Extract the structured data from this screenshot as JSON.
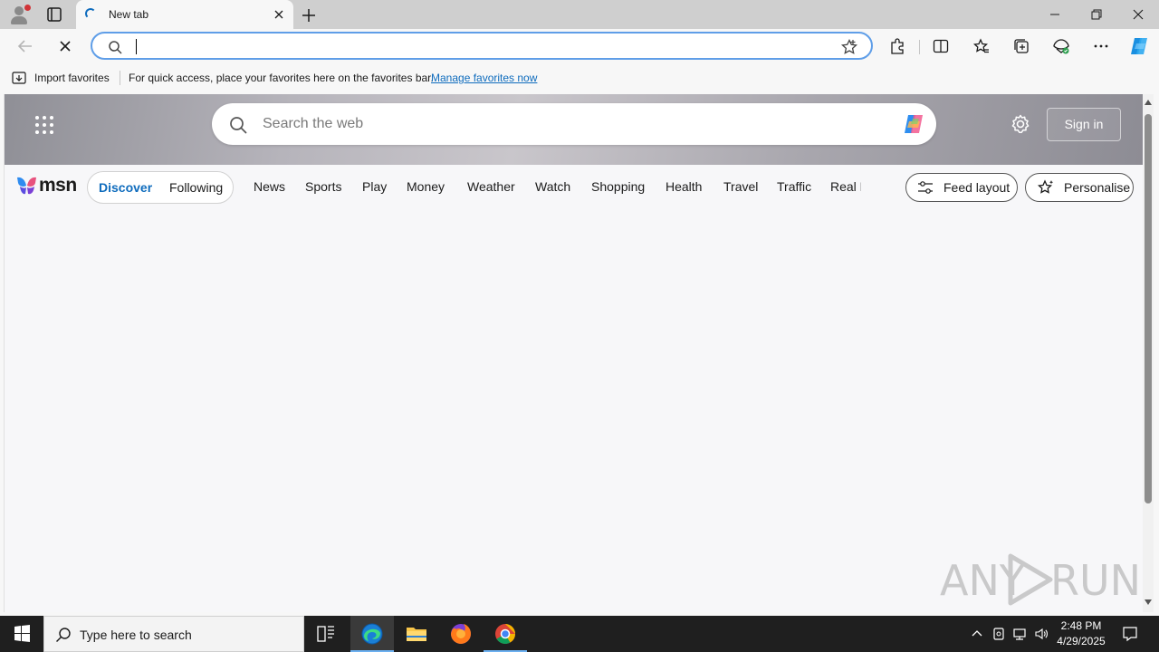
{
  "browser": {
    "tab_title": "New tab",
    "address_value": "",
    "favorites_bar": {
      "import_label": "Import favorites",
      "message": "For quick access, place your favorites here on the favorites bar.",
      "link": "Manage favorites now"
    }
  },
  "msn": {
    "search_placeholder": "Search the web",
    "sign_in": "Sign in",
    "logo_text": "msn",
    "feed_tabs": [
      "Discover",
      "Following"
    ],
    "nav_links": [
      "News",
      "Sports",
      "Play",
      "Money",
      "Weather",
      "Watch",
      "Shopping",
      "Health",
      "Travel",
      "Traffic",
      "Real E"
    ],
    "feed_layout": "Feed layout",
    "personalise": "Personalise"
  },
  "watermark": {
    "left": "ANY",
    "right": "RUN"
  },
  "taskbar": {
    "search_placeholder": "Type here to search",
    "time": "2:48 PM",
    "date": "4/29/2025"
  },
  "colors": {
    "accent": "#0f6cbd",
    "address_border": "#5f9ee8",
    "taskbar": "#1f1f1f"
  }
}
